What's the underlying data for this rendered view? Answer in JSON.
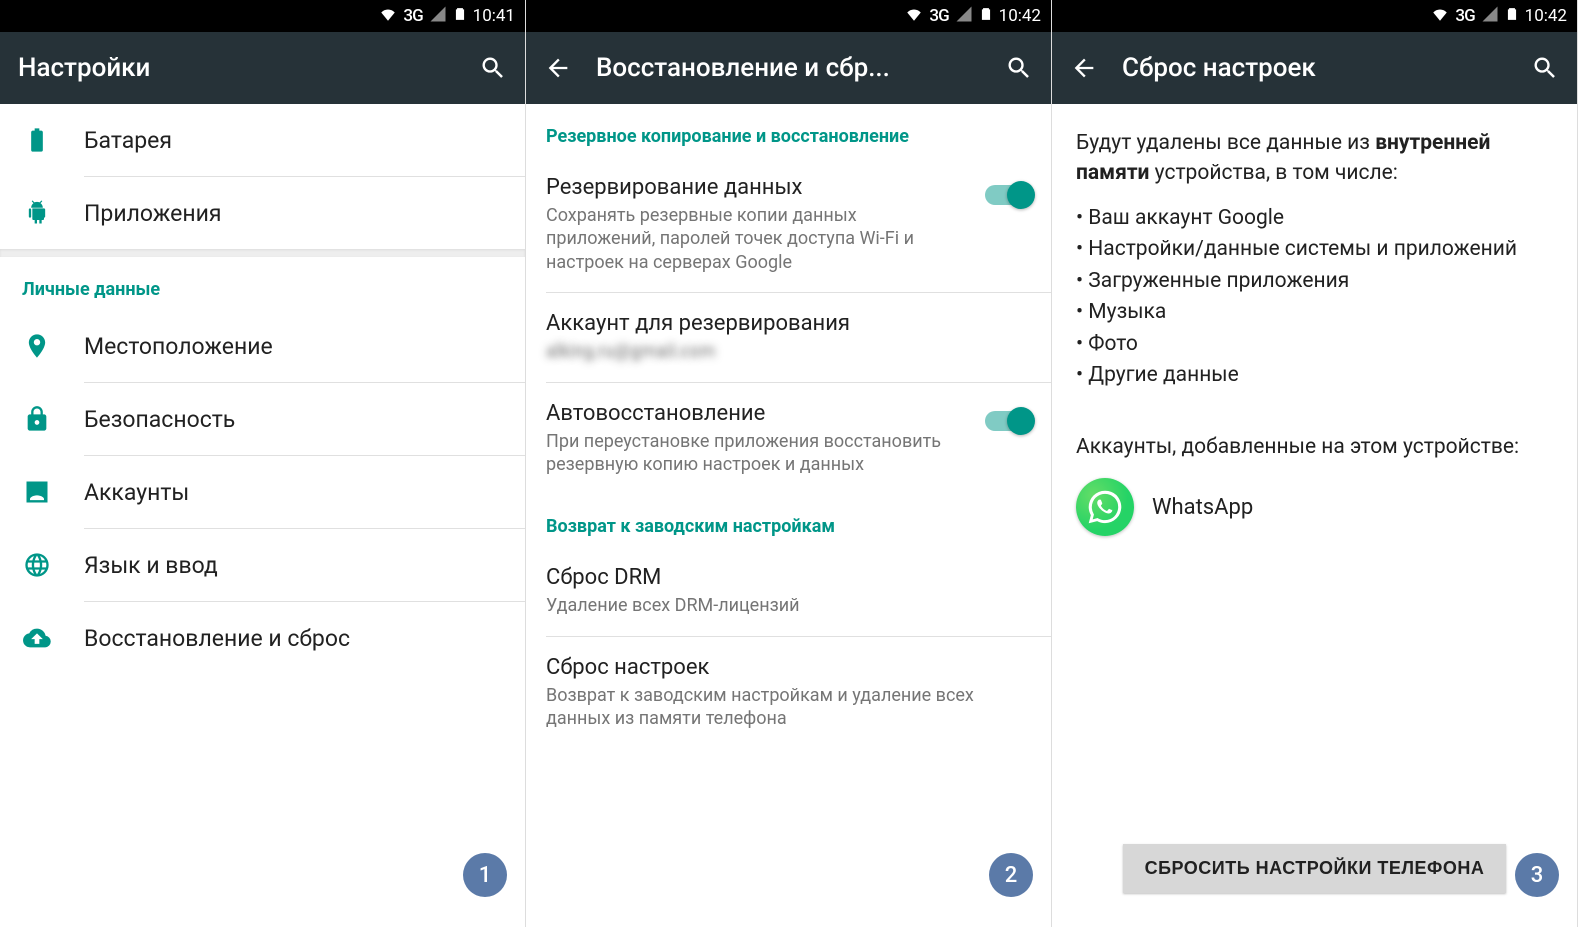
{
  "statusbar": {
    "network": "3G",
    "time1": "10:41",
    "time2": "10:42",
    "time3": "10:42"
  },
  "screen1": {
    "title": "Настройки",
    "items": {
      "battery": "Батарея",
      "apps": "Приложения"
    },
    "section_personal": "Личные данные",
    "personal": {
      "location": "Местоположение",
      "security": "Безопасность",
      "accounts": "Аккаунты",
      "language": "Язык и ввод",
      "backup_reset": "Восстановление и сброс"
    },
    "step": "1"
  },
  "screen2": {
    "title": "Восстановление и сбр...",
    "section_backup": "Резервное копирование и восстановление",
    "backup_data": {
      "title": "Резервирование данных",
      "sub": "Сохранять резервные копии данных приложений, паролей точек доступа Wi-Fi и настроек на серверах Google"
    },
    "backup_account": {
      "title": "Аккаунт для резервирования",
      "sub": "alking.ru@gmail.com"
    },
    "auto_restore": {
      "title": "Автовосстановление",
      "sub": "При переустановке приложения восстановить резервную копию настроек и данных"
    },
    "section_factory": "Возврат к заводским настройкам",
    "drm_reset": {
      "title": "Сброс DRM",
      "sub": "Удаление всех DRM-лицензий"
    },
    "factory_reset": {
      "title": "Сброс настроек",
      "sub": "Возврат к заводским настройкам и удаление всех данных из памяти телефона"
    },
    "step": "2"
  },
  "screen3": {
    "title": "Сброс настроек",
    "intro_pre": "Будут удалены все данные из ",
    "intro_bold": "внутренней памяти",
    "intro_post": " устройства, в том числе:",
    "bullets": {
      "b1": "Ваш аккаунт Google",
      "b2": "Настройки/данные системы и приложений",
      "b3": "Загруженные приложения",
      "b4": "Музыка",
      "b5": "Фото",
      "b6": "Другие данные"
    },
    "accounts_label": "Аккаунты, добавленные на этом устройстве:",
    "account_name": "WhatsApp",
    "button": "СБРОСИТЬ НАСТРОЙКИ ТЕЛЕФОНА",
    "step": "3"
  }
}
